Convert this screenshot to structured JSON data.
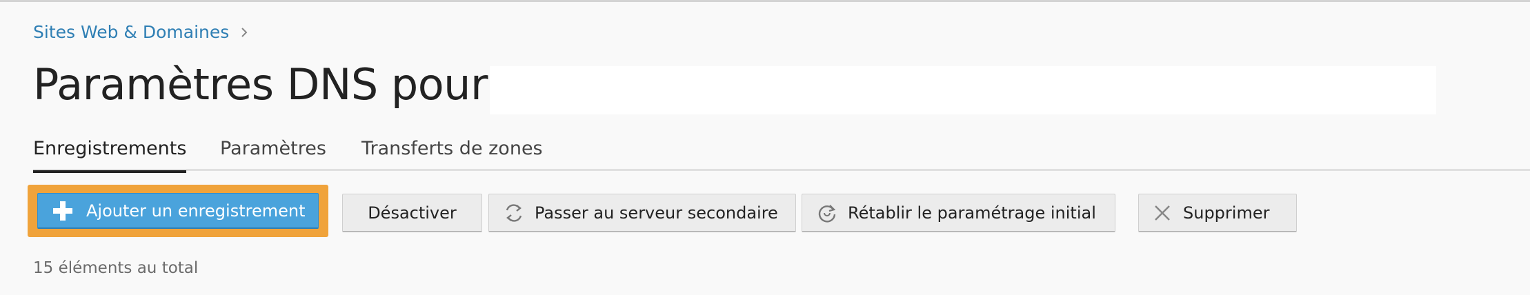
{
  "breadcrumb": {
    "label": "Sites Web & Domaines"
  },
  "page": {
    "title": "Paramètres DNS pour"
  },
  "tabs": [
    {
      "label": "Enregistrements",
      "active": true
    },
    {
      "label": "Paramètres",
      "active": false
    },
    {
      "label": "Transferts de zones",
      "active": false
    }
  ],
  "toolbar": {
    "add_label": "Ajouter un enregistrement",
    "disable_label": "Désactiver",
    "secondary_label": "Passer au serveur secondaire",
    "reset_label": "Rétablir le paramétrage initial",
    "delete_label": "Supprimer"
  },
  "status": {
    "total_text": "15 éléments au total"
  },
  "colors": {
    "link": "#2f7fb4",
    "primary_button": "#4aa3dc",
    "highlight": "#f0a33b"
  }
}
